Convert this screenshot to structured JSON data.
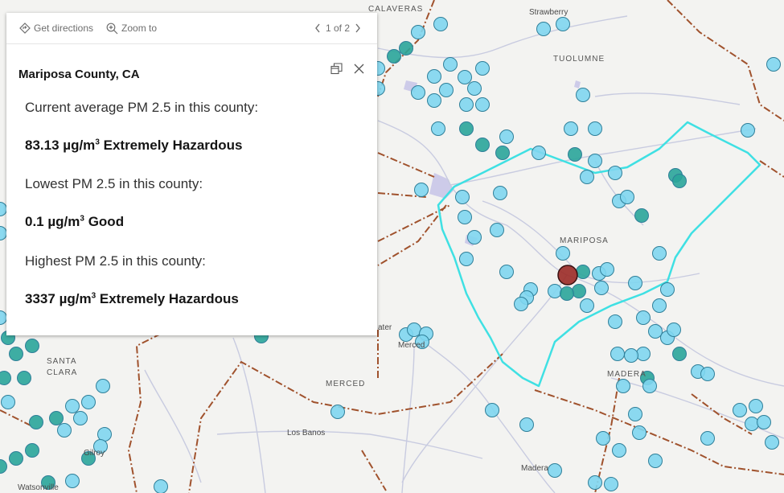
{
  "map": {
    "places": [
      {
        "id": "calaveras",
        "text": "CALAVERAS"
      },
      {
        "id": "strawberry",
        "text": "Strawberry"
      },
      {
        "id": "tuolumne",
        "text": "TUOLUMNE"
      },
      {
        "id": "mariposa",
        "text": "MARIPOSA"
      },
      {
        "id": "atwater",
        "text": "ater"
      },
      {
        "id": "merced-city",
        "text": "Merced"
      },
      {
        "id": "merced-county",
        "text": "MERCED"
      },
      {
        "id": "madera-county",
        "text": "MADERA"
      },
      {
        "id": "madera-city",
        "text": "Madera"
      },
      {
        "id": "los-banos",
        "text": "Los Banos"
      },
      {
        "id": "santa",
        "text": "SANTA"
      },
      {
        "id": "clara",
        "text": "CLARA"
      },
      {
        "id": "gilroy",
        "text": "Gilroy"
      },
      {
        "id": "watsonville",
        "text": "Watsonville"
      }
    ],
    "colors": {
      "sensor_fill": "#7fd6f0",
      "sensor_dark": "#2aa59a",
      "sensor_stroke": "#2f7f99",
      "hazard_fill": "#9b2a26",
      "selected_outline": "#3fe0e3",
      "county_border": "#a0522d"
    }
  },
  "popup": {
    "get_directions": "Get directions",
    "zoom_to": "Zoom to",
    "pager": "1 of 2",
    "title": "Mariposa County, CA",
    "rows": [
      {
        "label": "Current average PM 2.5 in this county:",
        "value": "83.13",
        "unit": "µg/m",
        "sup": "3",
        "category": "Extremely Hazardous"
      },
      {
        "label": "Lowest PM 2.5 in this county:",
        "value": "0.1",
        "unit": "µg/m",
        "sup": "3",
        "category": "Good"
      },
      {
        "label": "Highest PM 2.5 in this county:",
        "value": "3337",
        "unit": "µg/m",
        "sup": "3",
        "category": "Extremely Hazardous"
      }
    ]
  }
}
